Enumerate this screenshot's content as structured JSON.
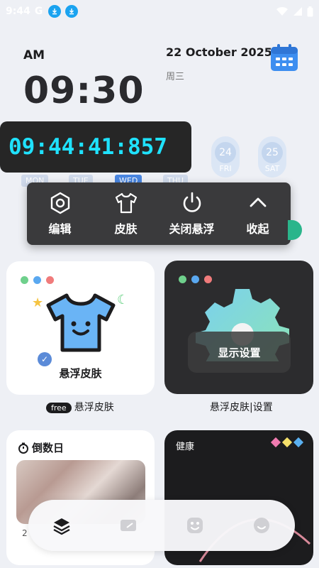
{
  "status_bar": {
    "time": "9:44",
    "carrier": "G"
  },
  "clock": {
    "ampm": "AM",
    "time": "09:30",
    "date": "22 October 2025",
    "weekday": "周三"
  },
  "week": {
    "days": [
      {
        "num": "24",
        "label": "FRI"
      },
      {
        "num": "25",
        "label": "SAT"
      }
    ],
    "labels": [
      "MON",
      "TUE",
      "WED",
      "THU"
    ]
  },
  "stopwatch": {
    "value": "09:44:41:857"
  },
  "float_menu": {
    "edit": "编辑",
    "skin": "皮肤",
    "close_float": "关闭悬浮",
    "collapse": "收起"
  },
  "cards": {
    "skin": {
      "title": "悬浮皮肤",
      "caption_badge": "free",
      "caption": "悬浮皮肤"
    },
    "display": {
      "button": "显示设置",
      "caption": "悬浮皮肤|设置"
    },
    "countdown": {
      "title": "倒数日",
      "footer": "2"
    },
    "health": {
      "title": "健康"
    }
  },
  "colors": {
    "accent_cyan": "#1fe2ff",
    "menu_bg": "#3a3a3c",
    "dot_green": "#6fd08c",
    "dot_blue": "#5aa8f0",
    "dot_red": "#f07b7b",
    "shirt_blue": "#6ab4f5"
  },
  "icons": {
    "edit": "hexagon-gear-icon",
    "skin": "tshirt-icon",
    "close_float": "power-icon",
    "collapse": "chevron-up-icon",
    "nav": [
      "layers-icon",
      "card-icon",
      "smile-face-icon",
      "smile-circle-icon"
    ]
  }
}
